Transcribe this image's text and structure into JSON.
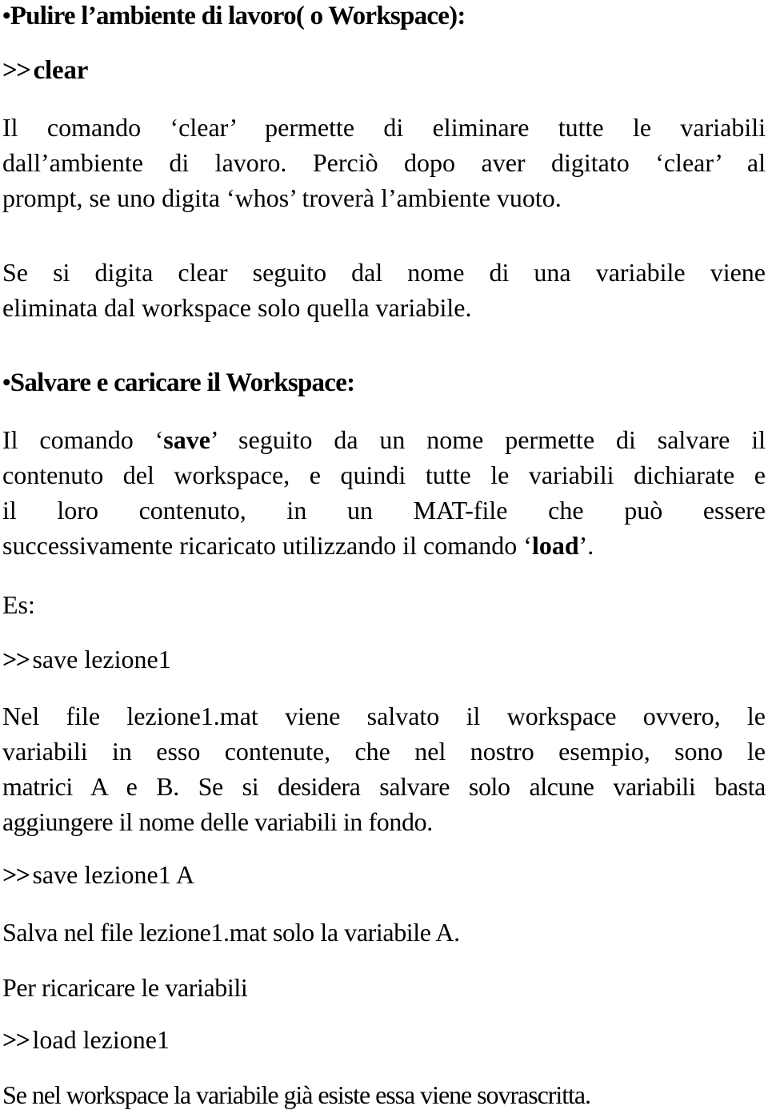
{
  "document": {
    "language": "it",
    "background_color": "#ffffff",
    "text_color": "#000000",
    "blocks": [
      {
        "id": "heading-pulire",
        "type": "heading",
        "bullet": "•",
        "text": "Pulire l’ambiente di lavoro( o Workspace):"
      },
      {
        "id": "prompt-clear",
        "type": "prompt",
        "chevron": ">>",
        "command": "clear"
      },
      {
        "id": "para-clear-1",
        "type": "paragraph",
        "lines": [
          "Il comando ‘clear’ permette di eliminare tutte le variabili",
          "dall’ambiente di lavoro. Perciò dopo aver digitato ‘clear’ al",
          "prompt, se uno digita ‘whos’ troverà l’ambiente vuoto."
        ]
      },
      {
        "id": "para-clear-2",
        "type": "paragraph",
        "lines": [
          "Se si digita clear seguito dal nome di una variabile viene",
          "eliminata dal workspace solo quella variabile."
        ]
      },
      {
        "id": "heading-salvare",
        "type": "heading",
        "bullet": "•",
        "text": "Salvare e caricare il Workspace:"
      },
      {
        "id": "para-save-1",
        "type": "paragraph",
        "lines": [
          "Il comando ‘save’ seguito da un nome permette di salvare il",
          "contenuto del workspace, e quindi tutte le variabili dichiarate e",
          "il loro contenuto, in un MAT-file che può essere",
          "successivamente ricaricato utilizzando il comando ‘load’."
        ],
        "bold_terms": [
          "save",
          "load"
        ]
      },
      {
        "id": "label-es",
        "type": "label",
        "text": "Es:"
      },
      {
        "id": "prompt-save-lezione1",
        "type": "prompt",
        "chevron": ">>",
        "command": "save lezione1"
      },
      {
        "id": "para-nelfile",
        "type": "paragraph",
        "lines": [
          "Nel file lezione1.mat viene salvato il workspace ovvero,  le",
          "variabili in esso contenute, che nel nostro esempio, sono le",
          "matrici A e B. Se si desidera salvare solo alcune variabili basta",
          "aggiungere il nome delle variabili in fondo."
        ]
      },
      {
        "id": "prompt-save-lezione1-a",
        "type": "prompt",
        "chevron": ">>",
        "command": "save lezione1 A"
      },
      {
        "id": "para-salva-nel-file",
        "type": "paragraph",
        "lines": [
          "Salva nel file lezione1.mat solo la variabile A."
        ]
      },
      {
        "id": "para-per-ricaricare",
        "type": "paragraph",
        "lines": [
          "Per ricaricare le variabili"
        ]
      },
      {
        "id": "prompt-load-lezione1",
        "type": "prompt",
        "chevron": ">>",
        "command": "load lezione1"
      },
      {
        "id": "para-sovrascritta",
        "type": "paragraph",
        "lines": [
          "Se nel workspace la variabile già esiste essa viene sovrascritta."
        ]
      }
    ]
  },
  "headings": {
    "pulire": {
      "bullet": "•",
      "text": "Pulire l’ambiente di lavoro( o Workspace):"
    },
    "salvare": {
      "bullet": "•",
      "text": "Salvare e caricare il Workspace:"
    }
  },
  "prompts": {
    "clear": {
      "chevron": ">>",
      "command": "clear"
    },
    "save_lezione1": {
      "chevron": ">>",
      "command": "save lezione1"
    },
    "save_lezione1_a": {
      "chevron": ">>",
      "command": "save lezione1 A"
    },
    "load_lezione1": {
      "chevron": ">>",
      "command": "load lezione1"
    }
  },
  "labels": {
    "es": "Es:"
  },
  "paragraphs": {
    "clear_1": {
      "l1": "Il comando ‘clear’ permette di eliminare tutte le variabili",
      "l2": "dall’ambiente di lavoro. Perciò dopo aver digitato ‘clear’ al",
      "l3": "prompt, se uno digita ‘whos’ troverà l’ambiente vuoto."
    },
    "clear_2": {
      "l1": "Se si digita clear seguito dal nome di una variabile viene",
      "l2": "eliminata dal workspace solo quella variabile."
    },
    "save_1": {
      "l1a": "Il comando ‘",
      "l1b": "save",
      "l1c": "’ seguito da un nome permette di salvare il",
      "l2": "contenuto del workspace, e quindi tutte le variabili dichiarate e",
      "l3": "il loro contenuto, in un MAT-file che può essere",
      "l4a": "successivamente ricaricato utilizzando il comando ‘",
      "l4b": "load",
      "l4c": "’."
    },
    "nelfile": {
      "l1": "Nel file lezione1.mat viene salvato il workspace ovvero,  le",
      "l2": "variabili in esso contenute, che nel nostro esempio, sono le",
      "l3": "matrici A e B. Se si desidera salvare solo alcune variabili basta",
      "l4": "aggiungere il nome delle variabili in fondo."
    },
    "salva_nel_file": {
      "l1": "Salva nel file lezione1.mat solo la variabile A."
    },
    "per_ricaricare": {
      "l1": "Per ricaricare le variabili"
    },
    "sovrascritta": {
      "l1": "Se nel workspace la variabile già esiste essa viene sovrascritta."
    }
  }
}
